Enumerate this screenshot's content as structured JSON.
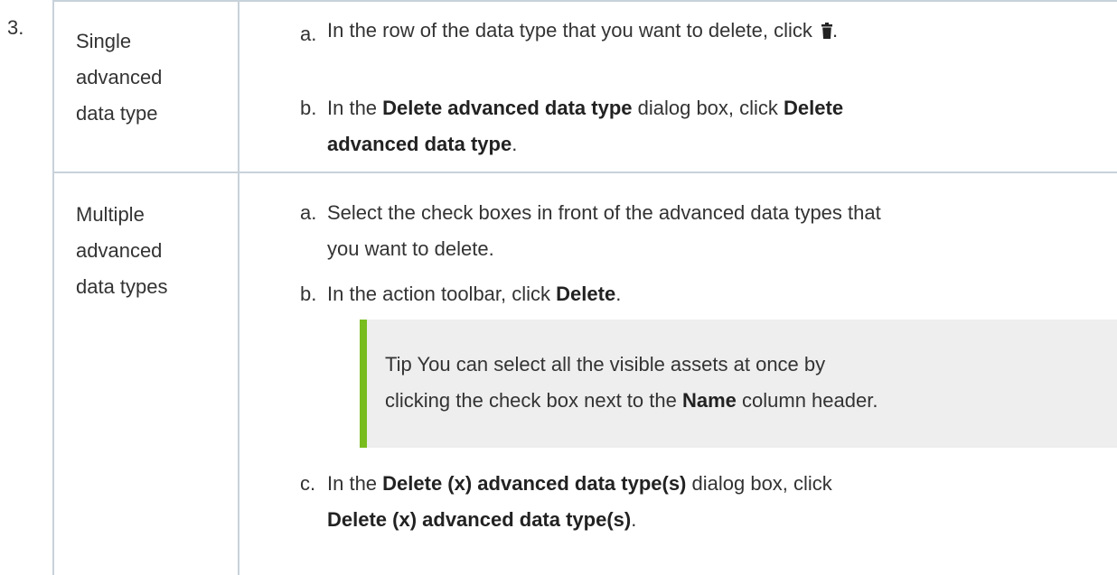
{
  "step_number": "3.",
  "rows": [
    {
      "label": [
        "Single",
        "advanced",
        "data type"
      ],
      "steps": [
        {
          "letter": "a.",
          "lines": [
            [
              {
                "t": "In the row of the data type that you want to delete, click "
              },
              {
                "icon": "trash-icon"
              },
              {
                "t": "."
              }
            ]
          ]
        },
        {
          "letter": "b.",
          "lines": [
            [
              {
                "t": "In the "
              },
              {
                "b": "Delete advanced data type"
              },
              {
                "t": " dialog box, click "
              },
              {
                "b": "Delete"
              }
            ],
            [
              {
                "b": "advanced data type"
              },
              {
                "t": "."
              }
            ]
          ]
        }
      ]
    },
    {
      "label": [
        "Multiple",
        "advanced",
        "data types"
      ],
      "steps": [
        {
          "letter": "a.",
          "lines": [
            [
              {
                "t": "Select the check boxes in front of the advanced data types that"
              }
            ],
            [
              {
                "t": "you want to delete."
              }
            ]
          ]
        },
        {
          "letter": "b.",
          "lines": [
            [
              {
                "t": "In the action toolbar, click "
              },
              {
                "b": "Delete"
              },
              {
                "t": "."
              }
            ]
          ]
        },
        {
          "letter": "c.",
          "lines": [
            [
              {
                "t": "In the "
              },
              {
                "b": "Delete (x) advanced data type(s)"
              },
              {
                "t": " dialog box, click"
              }
            ],
            [
              {
                "b": "Delete (x) advanced data type(s)"
              },
              {
                "t": "."
              }
            ]
          ]
        }
      ]
    }
  ],
  "tip": {
    "lines": [
      [
        {
          "t": "Tip   You can select all the visible assets at once by"
        }
      ],
      [
        {
          "t": "clicking the check box next to the "
        },
        {
          "b": "Name"
        },
        {
          "t": " column header."
        }
      ]
    ]
  },
  "colors": {
    "text": "#333333",
    "border": "#c8d2da",
    "tip_background": "#eeeeee",
    "tip_accent": "#78bc1e"
  }
}
